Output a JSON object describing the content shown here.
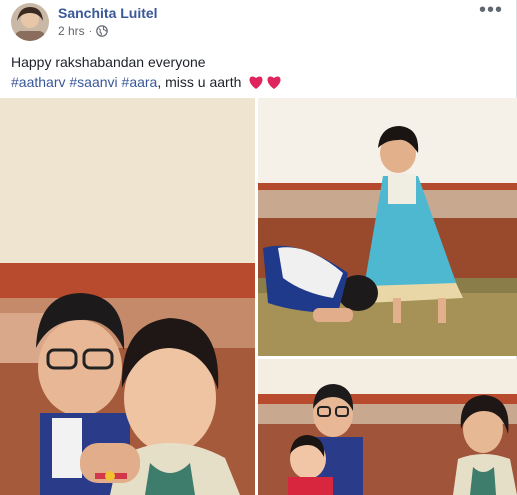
{
  "post": {
    "author": "Sanchita Luitel",
    "time": "2 hrs",
    "privacy_icon": "globe-icon",
    "more_label": "•••",
    "line1": "Happy rakshabandan everyone",
    "tags": [
      "#aatharv",
      "#saanvi",
      "#aara"
    ],
    "tag_sep": " ",
    "line2_suffix": ", miss u aarth",
    "hearts_icon": "heart-icon"
  },
  "colors": {
    "link": "#385898",
    "text": "#1d2129",
    "meta": "#616770",
    "heart": "#e0245e"
  }
}
